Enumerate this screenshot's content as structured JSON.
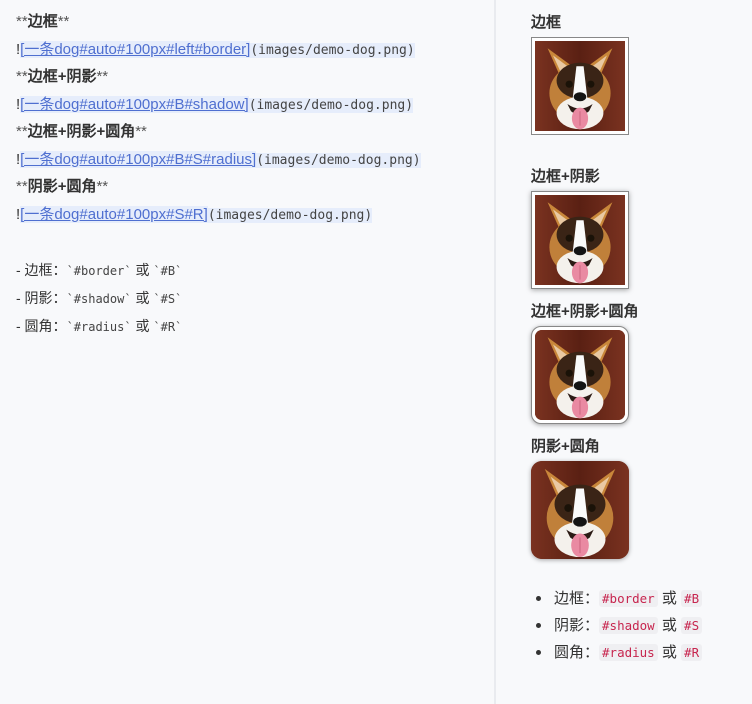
{
  "editor": {
    "lines": [
      {
        "pre": "**",
        "bold": "边框",
        "post": "**"
      },
      {
        "bang": "!",
        "link": "[一条dog#auto#100px#left#border]",
        "url": "(images/demo-dog.png)"
      },
      {
        "pre": "**",
        "bold": "边框+阴影",
        "post": "**"
      },
      {
        "bang": "!",
        "link": "[一条dog#auto#100px#B#shadow]",
        "url": "(images/demo-dog.png)"
      },
      {
        "pre": "**",
        "bold": "边框+阴影+圆角",
        "post": "**"
      },
      {
        "bang": "!",
        "link": "[一条dog#auto#100px#B#S#radius]",
        "url": "(images/demo-dog.png)"
      },
      {
        "pre": "**",
        "bold": "阴影+圆角",
        "post": "**"
      },
      {
        "bang": "!",
        "link": "[一条dog#auto#100px#S#R]",
        "url": "(images/demo-dog.png)"
      }
    ],
    "list": [
      {
        "label": "- 边框：",
        "code1": "`#border`",
        "or": " 或 ",
        "code2": "`#B`"
      },
      {
        "label": "- 阴影：",
        "code1": "`#shadow`",
        "or": " 或 ",
        "code2": "`#S`"
      },
      {
        "label": "- 圆角：",
        "code1": "`#radius`",
        "or": " 或 ",
        "code2": "`#R`"
      }
    ]
  },
  "preview": {
    "sections": [
      {
        "title": "边框",
        "alt": "一条dog"
      },
      {
        "title": "边框+阴影",
        "alt": "一条dog"
      },
      {
        "title": "边框+阴影+圆角",
        "alt": "一条dog"
      },
      {
        "title": "阴影+圆角",
        "alt": "一条dog"
      }
    ],
    "list": [
      {
        "label": "边框：",
        "code1": "#border",
        "or": " 或 ",
        "code2": "#B"
      },
      {
        "label": "阴影：",
        "code1": "#shadow",
        "or": " 或 ",
        "code2": "#S"
      },
      {
        "label": "圆角：",
        "code1": "#radius",
        "or": " 或 ",
        "code2": "#R"
      }
    ]
  },
  "colors": {
    "link": "#4f6fd0",
    "link_bg": "#e6edfb",
    "inline_code": "#c7254e",
    "background": "#f8f9fb"
  },
  "icons": {
    "image": "corgi-dog-photo"
  }
}
